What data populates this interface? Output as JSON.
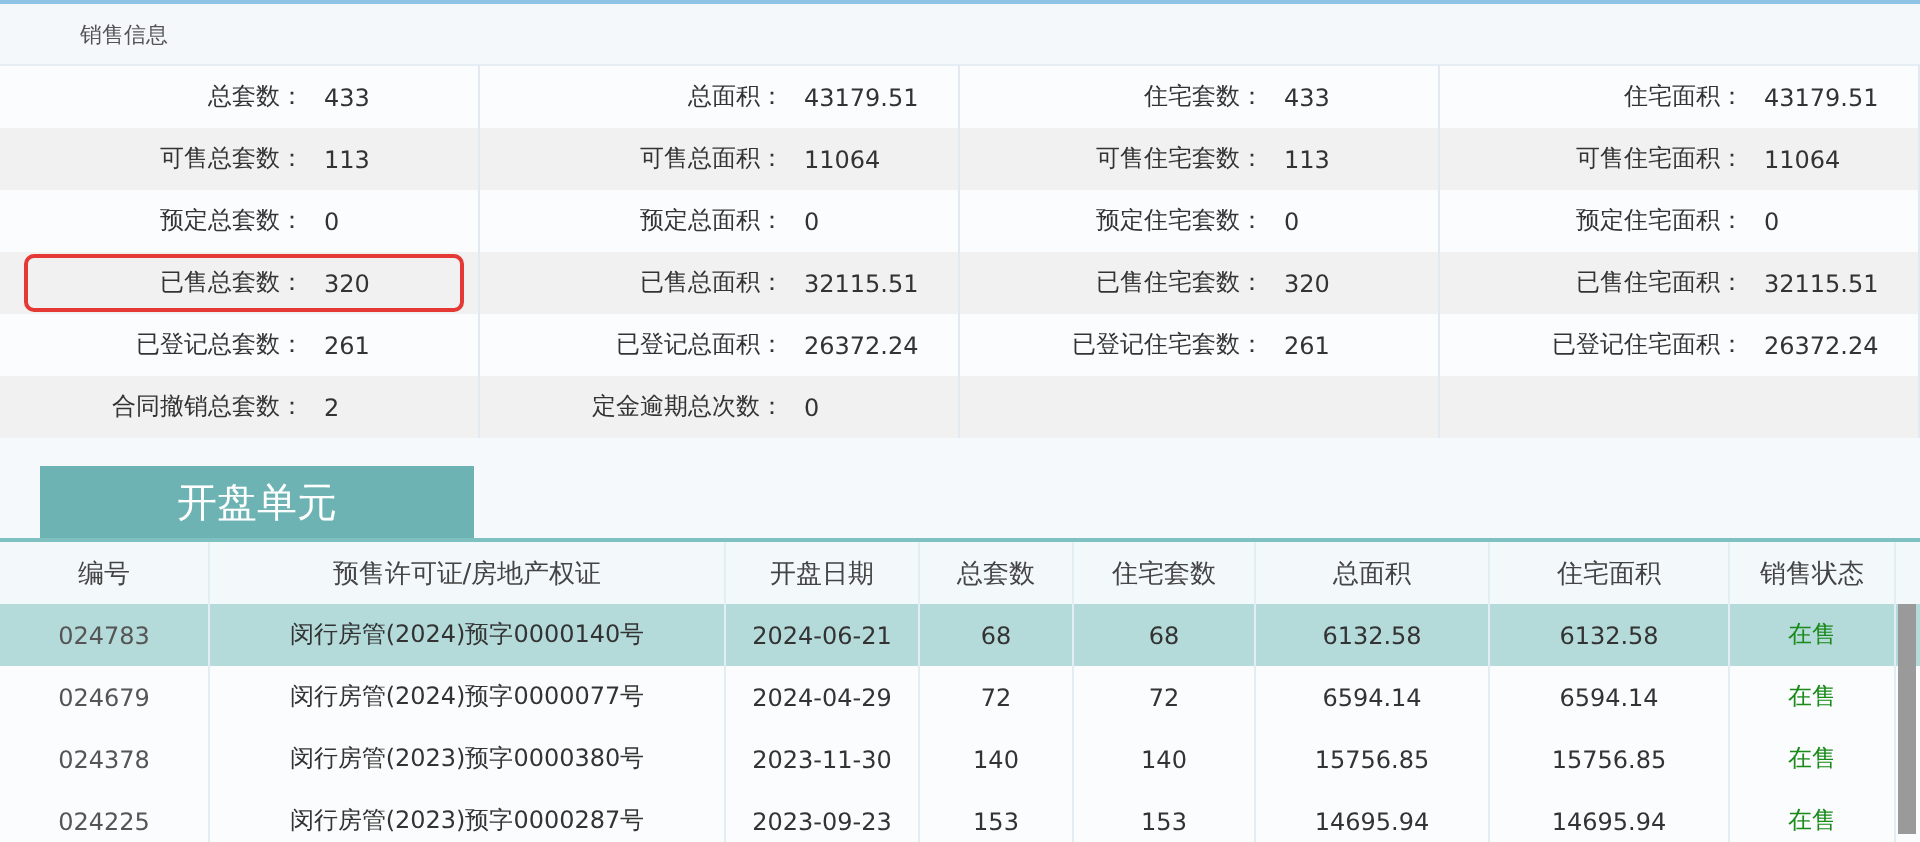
{
  "section_title": "销售信息",
  "stats": [
    [
      {
        "label": "总套数：",
        "value": "433",
        "highlighted": false
      },
      {
        "label": "总面积：",
        "value": "43179.51",
        "highlighted": false
      },
      {
        "label": "住宅套数：",
        "value": "433",
        "highlighted": false
      },
      {
        "label": "住宅面积：",
        "value": "43179.51",
        "highlighted": false
      }
    ],
    [
      {
        "label": "可售总套数：",
        "value": "113",
        "highlighted": false
      },
      {
        "label": "可售总面积：",
        "value": "11064",
        "highlighted": false
      },
      {
        "label": "可售住宅套数：",
        "value": "113",
        "highlighted": false
      },
      {
        "label": "可售住宅面积：",
        "value": "11064",
        "highlighted": false
      }
    ],
    [
      {
        "label": "预定总套数：",
        "value": "0",
        "highlighted": false
      },
      {
        "label": "预定总面积：",
        "value": "0",
        "highlighted": false
      },
      {
        "label": "预定住宅套数：",
        "value": "0",
        "highlighted": false
      },
      {
        "label": "预定住宅面积：",
        "value": "0",
        "highlighted": false
      }
    ],
    [
      {
        "label": "已售总套数：",
        "value": "320",
        "highlighted": true
      },
      {
        "label": "已售总面积：",
        "value": "32115.51",
        "highlighted": false
      },
      {
        "label": "已售住宅套数：",
        "value": "320",
        "highlighted": false
      },
      {
        "label": "已售住宅面积：",
        "value": "32115.51",
        "highlighted": false
      }
    ],
    [
      {
        "label": "已登记总套数：",
        "value": "261",
        "highlighted": false
      },
      {
        "label": "已登记总面积：",
        "value": "26372.24",
        "highlighted": false
      },
      {
        "label": "已登记住宅套数：",
        "value": "261",
        "highlighted": false
      },
      {
        "label": "已登记住宅面积：",
        "value": "26372.24",
        "highlighted": false
      }
    ],
    [
      {
        "label": "合同撤销总套数：",
        "value": "2",
        "highlighted": false
      },
      {
        "label": "定金逾期总次数：",
        "value": "0",
        "highlighted": false
      }
    ]
  ],
  "tab": {
    "label": "开盘单元"
  },
  "table": {
    "columns": [
      "编号",
      "预售许可证/房地产权证",
      "开盘日期",
      "总套数",
      "住宅套数",
      "总面积",
      "住宅面积",
      "销售状态"
    ],
    "rows": [
      {
        "selected": true,
        "cells": [
          "024783",
          "闵行房管(2024)预字0000140号",
          "2024-06-21",
          "68",
          "68",
          "6132.58",
          "6132.58",
          "在售"
        ]
      },
      {
        "selected": false,
        "cells": [
          "024679",
          "闵行房管(2024)预字0000077号",
          "2024-04-29",
          "72",
          "72",
          "6594.14",
          "6594.14",
          "在售"
        ]
      },
      {
        "selected": false,
        "cells": [
          "024378",
          "闵行房管(2023)预字0000380号",
          "2023-11-30",
          "140",
          "140",
          "15756.85",
          "15756.85",
          "在售"
        ]
      },
      {
        "selected": false,
        "cells": [
          "024225",
          "闵行房管(2023)预字0000287号",
          "2023-09-23",
          "153",
          "153",
          "14695.94",
          "14695.94",
          "在售"
        ]
      }
    ]
  }
}
